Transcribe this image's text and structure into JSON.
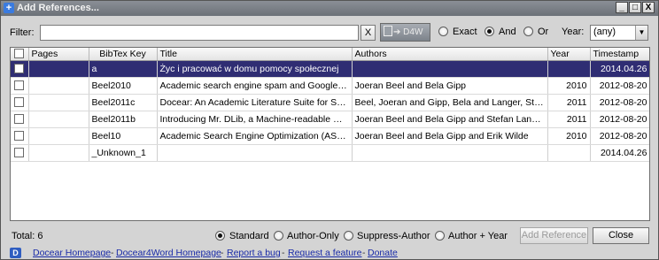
{
  "window": {
    "title": "Add References...",
    "minimize": "_",
    "maximize": "□",
    "close": "X"
  },
  "filter": {
    "label": "Filter:",
    "value": "",
    "clear_label": "X",
    "d4w_label": "D4W",
    "match_options": [
      {
        "label": "Exact",
        "checked": false
      },
      {
        "label": "And",
        "checked": true
      },
      {
        "label": "Or",
        "checked": false
      }
    ],
    "year_label": "Year:",
    "year_value": "(any)"
  },
  "table": {
    "columns": [
      "",
      "Pages",
      "BibTex Key",
      "Title",
      "Authors",
      "Year",
      "Timestamp"
    ],
    "rows": [
      {
        "selected": true,
        "pages": "",
        "key": "a",
        "title": "Życ i pracować w domu pomocy społecznej",
        "authors": "",
        "year": "",
        "timestamp": "2014.04.26"
      },
      {
        "selected": false,
        "pages": "",
        "key": "Beel2010",
        "title": "Academic search engine spam and Google Sch...",
        "authors": "Joeran Beel and Bela Gipp",
        "year": "2010",
        "timestamp": "2012-08-20"
      },
      {
        "selected": false,
        "pages": "",
        "key": "Beel2011c",
        "title": "Docear: An Academic Literature Suite for Searc...",
        "authors": "Beel, Joeran and Gipp, Bela and Langer, Stefan ...",
        "year": "2011",
        "timestamp": "2012-08-20"
      },
      {
        "selected": false,
        "pages": "",
        "key": "Beel2011b",
        "title": "Introducing Mr. DLib, a Machine-readable Digital...",
        "authors": "Joeran Beel and Bela Gipp and Stefan Langer a...",
        "year": "2011",
        "timestamp": "2012-08-20"
      },
      {
        "selected": false,
        "pages": "",
        "key": "Beel10",
        "title": "Academic Search Engine Optimization (ASEO): ...",
        "authors": "Joeran Beel and Bela Gipp and Erik Wilde",
        "year": "2010",
        "timestamp": "2012-08-20"
      },
      {
        "selected": false,
        "pages": "",
        "key": "_Unknown_1",
        "title": "",
        "authors": "",
        "year": "",
        "timestamp": "2014.04.26"
      }
    ]
  },
  "footer": {
    "total": "Total: 6",
    "styles": [
      {
        "label": "Standard",
        "checked": true
      },
      {
        "label": "Author-Only",
        "checked": false
      },
      {
        "label": "Suppress-Author",
        "checked": false
      },
      {
        "label": "Author + Year",
        "checked": false
      }
    ],
    "add_label": "Add Reference",
    "close_label": "Close"
  },
  "links": [
    {
      "label": "Docear Homepage"
    },
    {
      "label": "Docear4Word Homepage"
    },
    {
      "label": "Report a bug"
    },
    {
      "label": "Request a feature"
    },
    {
      "label": "Donate"
    }
  ],
  "colors": {
    "selection": "#2f2d73",
    "link": "#1a2ba8"
  }
}
